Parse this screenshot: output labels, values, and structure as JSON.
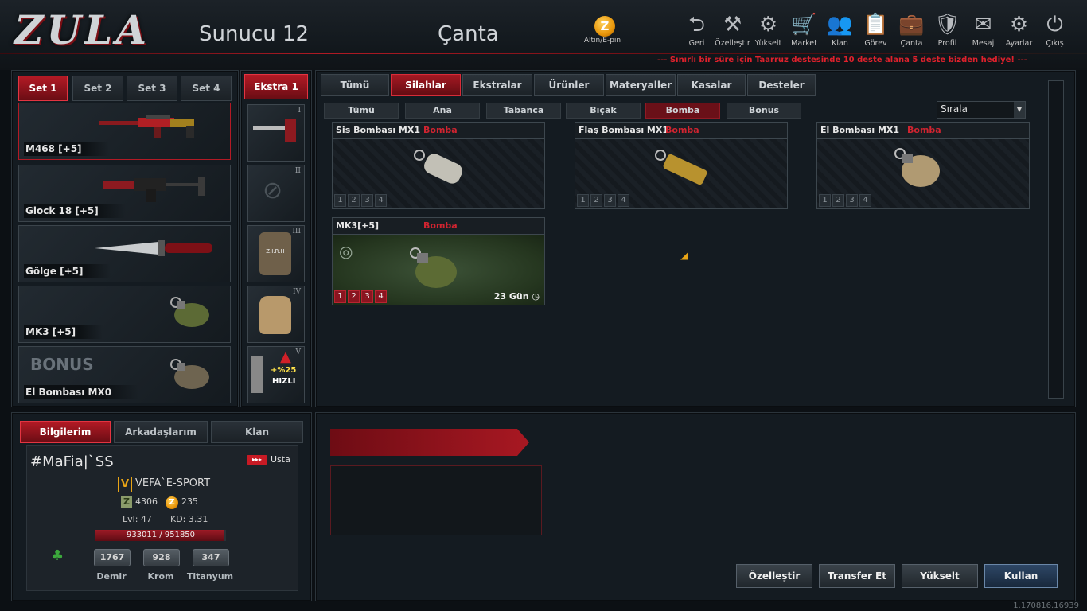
{
  "header": {
    "logo": "ZULA",
    "server": "Sunucu 12",
    "page_title": "Çanta",
    "gold": {
      "icon": "Z",
      "label": "Altın/E-pin"
    },
    "nav": [
      {
        "label": "Geri",
        "icon": "back-icon",
        "glyph": "⮌"
      },
      {
        "label": "Özelleştir",
        "icon": "tools-icon",
        "glyph": "⚒"
      },
      {
        "label": "Yükselt",
        "icon": "upgrade-icon",
        "glyph": "⚙"
      },
      {
        "label": "Market",
        "icon": "cart-icon",
        "glyph": "🛒"
      },
      {
        "label": "Klan",
        "icon": "clan-icon",
        "glyph": "👥"
      },
      {
        "label": "Görev",
        "icon": "mission-icon",
        "glyph": "📋"
      },
      {
        "label": "Çanta",
        "icon": "bag-icon",
        "glyph": "💼"
      },
      {
        "label": "Profil",
        "icon": "profile-icon",
        "glyph": "🛡"
      },
      {
        "label": "Mesaj",
        "icon": "mail-icon",
        "glyph": "✉"
      },
      {
        "label": "Ayarlar",
        "icon": "gear-icon",
        "glyph": "⚙"
      },
      {
        "label": "Çıkış",
        "icon": "power-icon",
        "glyph": "⏻"
      }
    ],
    "promo": "--- Sınırlı bir süre için Taarruz destesinde 10 deste alana 5 deste bizden hediye! ---"
  },
  "sets": {
    "tabs": [
      "Set 1",
      "Set 2",
      "Set 3",
      "Set 4"
    ],
    "active": 0,
    "slots": [
      {
        "label": "M468 [+5]"
      },
      {
        "label": "Glock 18 [+5]"
      },
      {
        "label": "Gölge [+5]"
      },
      {
        "label": "MK3 [+5]"
      },
      {
        "label": "El Bombası MX0",
        "bonus": "BONUS"
      }
    ]
  },
  "extra": {
    "tab": "Ekstra 1",
    "slots": [
      {
        "roman": "I"
      },
      {
        "roman": "II"
      },
      {
        "roman": "III",
        "text": "Z.I.R.H"
      },
      {
        "roman": "IV"
      },
      {
        "roman": "V",
        "boost": "+%25",
        "boost_label": "HIZLI"
      }
    ]
  },
  "categories": [
    "Tümü",
    "Silahlar",
    "Ekstralar",
    "Ürünler",
    "Materyaller",
    "Kasalar",
    "Desteler"
  ],
  "subcategories": [
    "Tümü",
    "Ana",
    "Tabanca",
    "Bıçak",
    "Bomba",
    "Bonus"
  ],
  "sort_label": "Sırala",
  "items": [
    {
      "name": "Sis Bombası MX1",
      "type": "Bomba",
      "slots": [
        "1",
        "2",
        "3",
        "4"
      ]
    },
    {
      "name": "Flaş Bombası MX1",
      "type": "Bomba",
      "slots": [
        "1",
        "2",
        "3",
        "4"
      ]
    },
    {
      "name": "El Bombası MX1",
      "type": "Bomba",
      "slots": [
        "1",
        "2",
        "3",
        "4"
      ]
    },
    {
      "name": "MK3[+5]",
      "type": "Bomba",
      "slots": [
        "1",
        "2",
        "3",
        "4"
      ],
      "days": "23 Gün"
    }
  ],
  "info": {
    "tabs": [
      "Bilgilerim",
      "Arkadaşlarım",
      "Klan"
    ],
    "username": "#MaFia|`SS",
    "rank": "Usta",
    "clan_badge": "V",
    "clan": "VEFA`E-SPORT",
    "z_points": "4306",
    "gold": "235",
    "level": "Lvl: 47",
    "kd": "KD: 3.31",
    "xp": "933011 / 951850",
    "xp_ratio": 0.98,
    "materials": [
      {
        "value": "1767",
        "label": "Demir"
      },
      {
        "value": "928",
        "label": "Krom"
      },
      {
        "value": "347",
        "label": "Titanyum"
      }
    ]
  },
  "actions": [
    "Özelleştir",
    "Transfer Et",
    "Yükselt",
    "Kullan"
  ],
  "version": "1.170816.16939"
}
